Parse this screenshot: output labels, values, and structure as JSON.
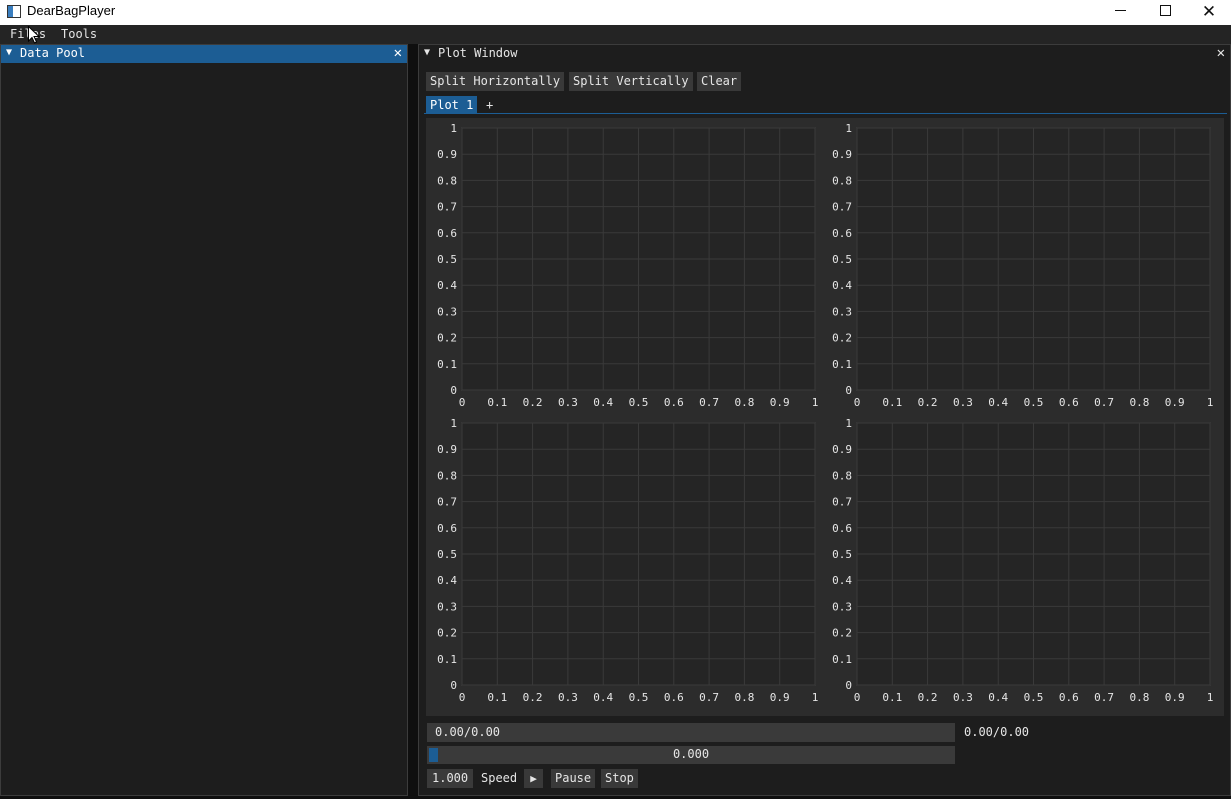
{
  "app": {
    "title": "DearBagPlayer"
  },
  "menu": {
    "files": "Files",
    "tools": "Tools"
  },
  "data_pool": {
    "title": "Data Pool",
    "close": "✕"
  },
  "plot_window": {
    "title": "Plot Window",
    "close": "✕",
    "buttons": {
      "split_h": "Split Horizontally",
      "split_v": "Split Vertically",
      "clear": "Clear"
    },
    "tabs": [
      {
        "label": "Plot 1",
        "active": true
      }
    ],
    "add_tab": "+"
  },
  "chart_data": [
    {
      "type": "line",
      "series": [],
      "xlim": [
        0,
        1
      ],
      "ylim": [
        0,
        1
      ],
      "x_ticks": [
        "0",
        "0.1",
        "0.2",
        "0.3",
        "0.4",
        "0.5",
        "0.6",
        "0.7",
        "0.8",
        "0.9",
        "1"
      ],
      "y_ticks": [
        "0",
        "0.1",
        "0.2",
        "0.3",
        "0.4",
        "0.5",
        "0.6",
        "0.7",
        "0.8",
        "0.9",
        "1"
      ],
      "grid": true
    },
    {
      "type": "line",
      "series": [],
      "xlim": [
        0,
        1
      ],
      "ylim": [
        0,
        1
      ],
      "x_ticks": [
        "0",
        "0.1",
        "0.2",
        "0.3",
        "0.4",
        "0.5",
        "0.6",
        "0.7",
        "0.8",
        "0.9",
        "1"
      ],
      "y_ticks": [
        "0",
        "0.1",
        "0.2",
        "0.3",
        "0.4",
        "0.5",
        "0.6",
        "0.7",
        "0.8",
        "0.9",
        "1"
      ],
      "grid": true
    },
    {
      "type": "line",
      "series": [],
      "xlim": [
        0,
        1
      ],
      "ylim": [
        0,
        1
      ],
      "x_ticks": [
        "0",
        "0.1",
        "0.2",
        "0.3",
        "0.4",
        "0.5",
        "0.6",
        "0.7",
        "0.8",
        "0.9",
        "1"
      ],
      "y_ticks": [
        "0",
        "0.1",
        "0.2",
        "0.3",
        "0.4",
        "0.5",
        "0.6",
        "0.7",
        "0.8",
        "0.9",
        "1"
      ],
      "grid": true
    },
    {
      "type": "line",
      "series": [],
      "xlim": [
        0,
        1
      ],
      "ylim": [
        0,
        1
      ],
      "x_ticks": [
        "0",
        "0.1",
        "0.2",
        "0.3",
        "0.4",
        "0.5",
        "0.6",
        "0.7",
        "0.8",
        "0.9",
        "1"
      ],
      "y_ticks": [
        "0",
        "0.1",
        "0.2",
        "0.3",
        "0.4",
        "0.5",
        "0.6",
        "0.7",
        "0.8",
        "0.9",
        "1"
      ],
      "grid": true
    }
  ],
  "player": {
    "time_field": "0.00/0.00",
    "time_label": "0.00/0.00",
    "slider_value": "0.000",
    "slider_fraction": 0,
    "speed_value": "1.000",
    "speed_label": "Speed",
    "play_icon": "▶",
    "pause": "Pause",
    "stop": "Stop"
  },
  "colors": {
    "accent": "#1c5d94",
    "panel_bg": "#1d1d1d",
    "plot_bg": "#2c2c2c",
    "grid": "#3a3a3a"
  }
}
